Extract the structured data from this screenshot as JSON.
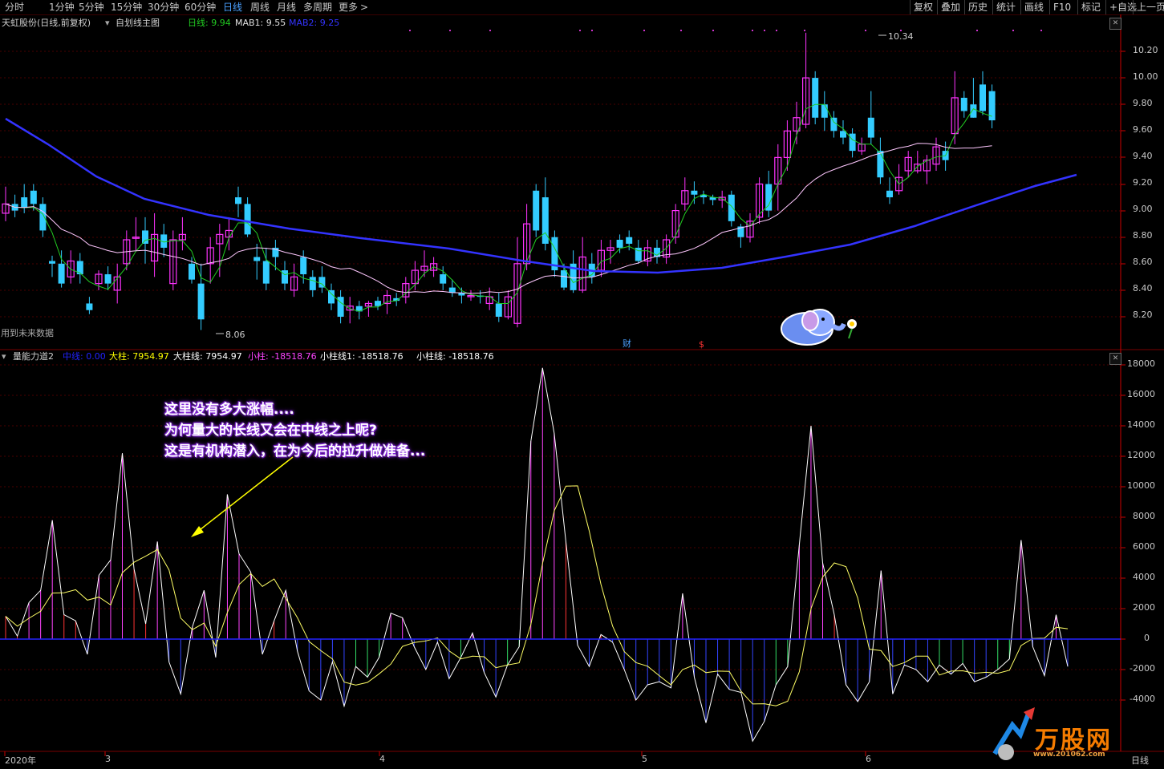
{
  "toolbar": {
    "periods": [
      "分时",
      "1分钟",
      "5分钟",
      "15分钟",
      "30分钟",
      "60分钟",
      "日线",
      "周线",
      "月线",
      "多周期",
      "更多"
    ],
    "active_period": "日线",
    "right_buttons": [
      "复权",
      "叠加",
      "历史",
      "统计",
      "画线",
      "F10",
      "标记",
      "+自选",
      "上一页"
    ],
    "more_chevron": ">"
  },
  "main_panel": {
    "stock_title": "天虹股份(日线,前复权)",
    "indicator_name": "自划线主图",
    "legend": [
      {
        "label": "日线: 9.94",
        "color": "#22cc22"
      },
      {
        "label": "MAB1: 9.55",
        "color": "#e0e0e0"
      },
      {
        "label": "MAB2: 9.25",
        "color": "#3333ff"
      }
    ],
    "future_data_note": "用到未来数据",
    "high_marker": "10.34",
    "low_marker": "8.06",
    "marker_cai": "财",
    "marker_dollar": "$",
    "y_ticks": [
      "10.20",
      "10.00",
      "9.80",
      "9.60",
      "9.40",
      "9.20",
      "9.00",
      "8.80",
      "8.60",
      "8.40",
      "8.20"
    ]
  },
  "sub_panel": {
    "indicator_name": "量能力道2",
    "legend": [
      {
        "label": "中线: 0.00",
        "color": "#2222ff"
      },
      {
        "label": "大柱: 7954.97",
        "color": "#ffff00"
      },
      {
        "label": "大柱线: 7954.97",
        "color": "#ffffff"
      },
      {
        "label": "小柱: -18518.76",
        "color": "#ff44ff"
      },
      {
        "label": "小柱线1: -18518.76",
        "color": "#ffffff"
      },
      {
        "label": "小柱线: -18518.76",
        "color": "#ffffff"
      }
    ],
    "y_ticks": [
      "18000",
      "16000",
      "14000",
      "12000",
      "10000",
      "8000",
      "6000",
      "4000",
      "2000",
      "0",
      "-2000",
      "-4000"
    ],
    "annotation_lines": [
      "这里没有多大涨幅....",
      "为何量大的长线又会在中线之上呢?",
      "这是有机构潜入，在为今后的拉升做准备..."
    ]
  },
  "x_axis": {
    "labels": [
      "2020年",
      "3",
      "4",
      "5",
      "6"
    ],
    "period_label": "日线"
  },
  "watermark": {
    "brand": "万股网",
    "url": "www.201062.com"
  },
  "colors": {
    "up_candle": "#ff33ff",
    "down_candle": "#33ccff",
    "ma_green": "#22cc22",
    "ma_pink": "#ffc8ff",
    "ma_blue": "#3333ff",
    "grid": "#4a0000",
    "axis_red": "#cc0000"
  }
}
